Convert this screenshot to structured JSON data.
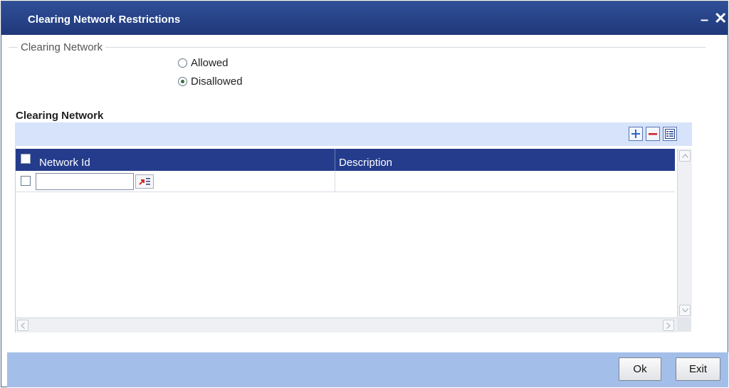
{
  "window": {
    "title": "Clearing Network Restrictions",
    "minimize_glyph": "–",
    "close_glyph": "✕"
  },
  "clearing_network_group": {
    "legend": "Clearing Network",
    "options": [
      {
        "label": "Allowed",
        "checked": false
      },
      {
        "label": "Disallowed",
        "checked": true
      }
    ]
  },
  "grid": {
    "caption": "Clearing Network",
    "toolbar": {
      "add_icon": "plus-icon",
      "delete_icon": "minus-icon",
      "view_icon": "list-view-icon"
    },
    "columns": [
      "Network Id",
      "Description"
    ],
    "rows": [
      {
        "network_id": "",
        "description": ""
      }
    ]
  },
  "footer": {
    "ok_label": "Ok",
    "exit_label": "Exit"
  },
  "colors": {
    "titlebar": "#243c8b",
    "grid_header": "#243c8b",
    "toolbar_band": "#d6e3fa",
    "footer_band": "#a3bee8"
  }
}
